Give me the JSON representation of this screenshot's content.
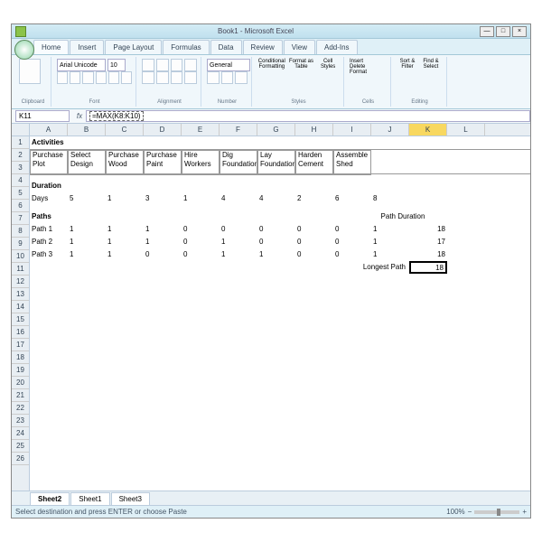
{
  "window": {
    "title": "Book1 - Microsoft Excel",
    "min": "—",
    "max": "□",
    "close": "×"
  },
  "ribbon_tabs": [
    "Home",
    "Insert",
    "Page Layout",
    "Formulas",
    "Data",
    "Review",
    "View",
    "Add-Ins"
  ],
  "ribbon_groups": {
    "clipboard": "Clipboard",
    "font": "Font",
    "alignment": "Alignment",
    "number": "Number",
    "styles": "Styles",
    "cells": "Cells",
    "editing": "Editing"
  },
  "font": {
    "name": "Arial Unicode ",
    "size": "10"
  },
  "number_format": "General",
  "styles": {
    "cond": "Conditional Formatting",
    "fmt": "Format as Table",
    "cell": "Cell Styles"
  },
  "cells_grp": {
    "insert": "Insert",
    "delete": "Delete",
    "format": "Format"
  },
  "editing": {
    "sort": "Sort & Filter",
    "find": "Find & Select"
  },
  "namebox": "K11",
  "formula": "=MAX(K8:K10)",
  "cols": [
    "A",
    "B",
    "C",
    "D",
    "E",
    "F",
    "G",
    "H",
    "I",
    "J",
    "K",
    "L"
  ],
  "rows": [
    "1",
    "2",
    "3",
    "4",
    "5",
    "6",
    "7",
    "8",
    "9",
    "10",
    "11",
    "12",
    "13",
    "14",
    "15",
    "16",
    "17",
    "18",
    "19",
    "20",
    "21",
    "22",
    "23",
    "24",
    "25",
    "26"
  ],
  "sheet": {
    "activities_hdr": "Activities",
    "activities": [
      "Purchase Plot",
      "Select Design",
      "Purchase Wood",
      "Purchase Paint",
      "Hire Workers",
      "Dig Foundation",
      "Lay Foundation",
      "Harden Cement",
      "Assemble Shed"
    ],
    "duration_hdr": "Duration",
    "days_label": "Days",
    "days": [
      "5",
      "1",
      "3",
      "1",
      "4",
      "4",
      "2",
      "6",
      "8"
    ],
    "paths_hdr": "Paths",
    "path_duration_hdr": "Path Duration",
    "paths": [
      {
        "name": "Path 1",
        "v": [
          "1",
          "1",
          "1",
          "0",
          "0",
          "0",
          "0",
          "0",
          "1"
        ],
        "dur": "18"
      },
      {
        "name": "Path 2",
        "v": [
          "1",
          "1",
          "1",
          "0",
          "1",
          "0",
          "0",
          "0",
          "1"
        ],
        "dur": "17"
      },
      {
        "name": "Path 3",
        "v": [
          "1",
          "1",
          "0",
          "0",
          "1",
          "1",
          "0",
          "0",
          "1"
        ],
        "dur": "18"
      }
    ],
    "longest_label": "Longest Path",
    "longest_value": "18"
  },
  "sheet_tabs": [
    "Sheet2",
    "Sheet1",
    "Sheet3"
  ],
  "status": {
    "msg": "Select destination and press ENTER or choose Paste",
    "zoom": "100%"
  }
}
